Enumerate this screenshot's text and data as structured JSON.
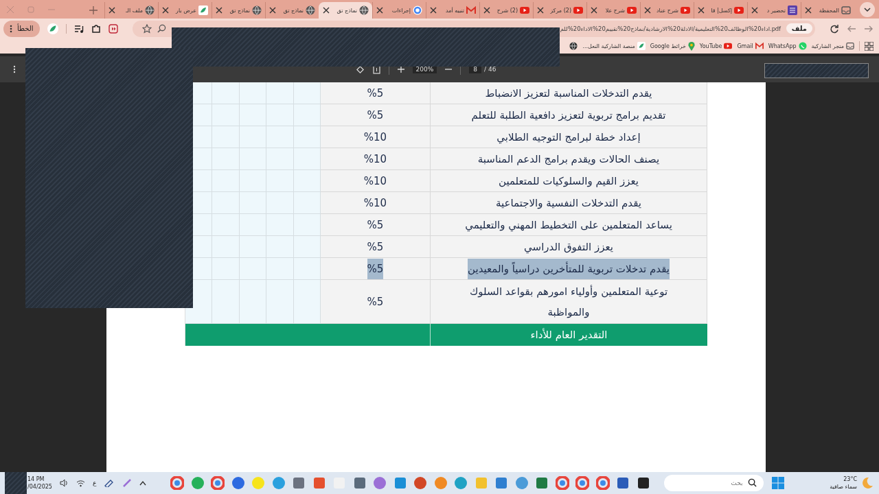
{
  "tabs": [
    {
      "label": "المحفظة",
      "selected": false
    },
    {
      "label": "تحضير د",
      "selected": false
    },
    {
      "label": "إكسل| قا",
      "selected": false
    },
    {
      "label": "شرح عناد",
      "selected": false
    },
    {
      "label": "شرح علا",
      "selected": false
    },
    {
      "label": "(2) مركز",
      "selected": false
    },
    {
      "label": "(2) شرح",
      "selected": false
    },
    {
      "label": "تنبيه أمد",
      "selected": false
    },
    {
      "label": "إجراءات",
      "selected": false
    },
    {
      "label": "نماذج تق",
      "selected": true
    },
    {
      "label": "نماذج تق",
      "selected": false
    },
    {
      "label": "نماذج تق",
      "selected": false
    },
    {
      "label": "عرض بار",
      "selected": false
    },
    {
      "label": "ملف الـ",
      "selected": false
    }
  ],
  "address": {
    "chip": "ملف",
    "url": "pdf.اداء20%الوظائف20%التعليمية/الادلة20%الارشادية/نماذج20%تقييم20%الاداء20%للم"
  },
  "profile_button": "الخطأ",
  "bookmarks": [
    "متجر الشاركية",
    "WhatsApp",
    "Gmail",
    "YouTube",
    "خرائط Google",
    "منصة الشاركية النعل..."
  ],
  "pdf_toolbar": {
    "zoom": "200%",
    "page": "8",
    "page_count": "/ 46"
  },
  "table": {
    "rows": [
      {
        "criterion": "يقدم التدخلات المناسبة لتعزيز الانضباط",
        "weight": "%5",
        "highlighted": false
      },
      {
        "criterion": "تقديم برامج تربوية  لتعزيز دافعية الطلبة للتعلم",
        "weight": "%5",
        "highlighted": false
      },
      {
        "criterion": "إعداد خطة لبرامج التوجيه الطلابي",
        "weight": "%10",
        "highlighted": false
      },
      {
        "criterion": "يصنف الحالات ويقدم برامج الدعم المناسبة",
        "weight": "%10",
        "highlighted": false
      },
      {
        "criterion": "يعزز القيم والسلوكيات للمتعلمين",
        "weight": "%10",
        "highlighted": false
      },
      {
        "criterion": "يقدم التدخلات النفسية والاجتماعية",
        "weight": "%10",
        "highlighted": false
      },
      {
        "criterion": "يساعد المتعلمين على التخطيط المهني والتعليمي",
        "weight": "%5",
        "highlighted": false
      },
      {
        "criterion": "يعزز  التفوق الدراسي",
        "weight": "%5",
        "highlighted": false
      },
      {
        "criterion": "يقدم تدخلات  تربوية للمتأخرين دراسياً والمعيدين",
        "weight": "%5",
        "highlighted": true
      },
      {
        "criterion": "توعية المتعلمين وأولياء امورهم بقواعد السلوك والمواظبة",
        "weight": "%5",
        "highlighted": false
      }
    ],
    "footer": "التقدير العام للأداء"
  },
  "taskbar": {
    "time": "14 PM",
    "date": "/04/2025",
    "input_indicator": "ع",
    "search": {
      "placeholder": "بحث"
    },
    "weather": {
      "temperature": "23°C",
      "condition": "سماء صافية"
    }
  }
}
